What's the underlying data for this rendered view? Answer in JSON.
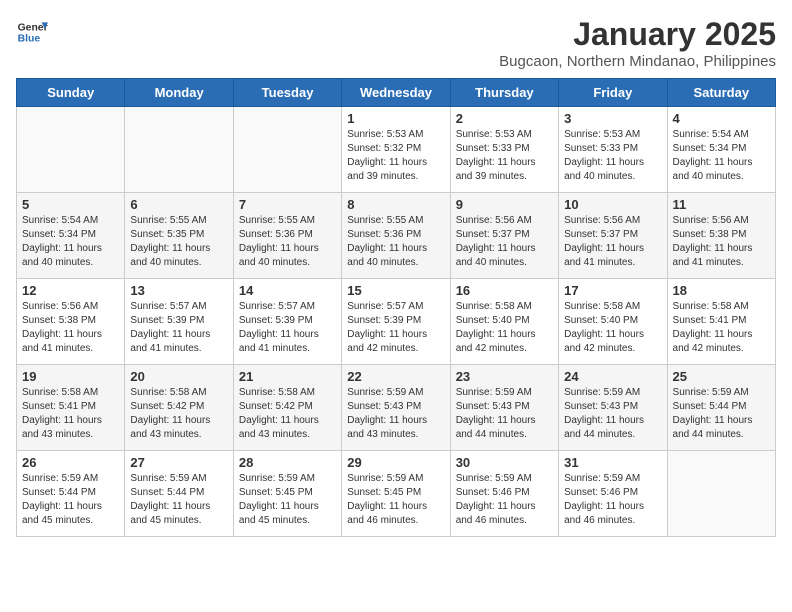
{
  "header": {
    "logo_general": "General",
    "logo_blue": "Blue",
    "title": "January 2025",
    "subtitle": "Bugcaon, Northern Mindanao, Philippines"
  },
  "days_of_week": [
    "Sunday",
    "Monday",
    "Tuesday",
    "Wednesday",
    "Thursday",
    "Friday",
    "Saturday"
  ],
  "weeks": [
    [
      {
        "day": "",
        "sunrise": "",
        "sunset": "",
        "daylight": ""
      },
      {
        "day": "",
        "sunrise": "",
        "sunset": "",
        "daylight": ""
      },
      {
        "day": "",
        "sunrise": "",
        "sunset": "",
        "daylight": ""
      },
      {
        "day": "1",
        "sunrise": "Sunrise: 5:53 AM",
        "sunset": "Sunset: 5:32 PM",
        "daylight": "Daylight: 11 hours and 39 minutes."
      },
      {
        "day": "2",
        "sunrise": "Sunrise: 5:53 AM",
        "sunset": "Sunset: 5:33 PM",
        "daylight": "Daylight: 11 hours and 39 minutes."
      },
      {
        "day": "3",
        "sunrise": "Sunrise: 5:53 AM",
        "sunset": "Sunset: 5:33 PM",
        "daylight": "Daylight: 11 hours and 40 minutes."
      },
      {
        "day": "4",
        "sunrise": "Sunrise: 5:54 AM",
        "sunset": "Sunset: 5:34 PM",
        "daylight": "Daylight: 11 hours and 40 minutes."
      }
    ],
    [
      {
        "day": "5",
        "sunrise": "Sunrise: 5:54 AM",
        "sunset": "Sunset: 5:34 PM",
        "daylight": "Daylight: 11 hours and 40 minutes."
      },
      {
        "day": "6",
        "sunrise": "Sunrise: 5:55 AM",
        "sunset": "Sunset: 5:35 PM",
        "daylight": "Daylight: 11 hours and 40 minutes."
      },
      {
        "day": "7",
        "sunrise": "Sunrise: 5:55 AM",
        "sunset": "Sunset: 5:36 PM",
        "daylight": "Daylight: 11 hours and 40 minutes."
      },
      {
        "day": "8",
        "sunrise": "Sunrise: 5:55 AM",
        "sunset": "Sunset: 5:36 PM",
        "daylight": "Daylight: 11 hours and 40 minutes."
      },
      {
        "day": "9",
        "sunrise": "Sunrise: 5:56 AM",
        "sunset": "Sunset: 5:37 PM",
        "daylight": "Daylight: 11 hours and 40 minutes."
      },
      {
        "day": "10",
        "sunrise": "Sunrise: 5:56 AM",
        "sunset": "Sunset: 5:37 PM",
        "daylight": "Daylight: 11 hours and 41 minutes."
      },
      {
        "day": "11",
        "sunrise": "Sunrise: 5:56 AM",
        "sunset": "Sunset: 5:38 PM",
        "daylight": "Daylight: 11 hours and 41 minutes."
      }
    ],
    [
      {
        "day": "12",
        "sunrise": "Sunrise: 5:56 AM",
        "sunset": "Sunset: 5:38 PM",
        "daylight": "Daylight: 11 hours and 41 minutes."
      },
      {
        "day": "13",
        "sunrise": "Sunrise: 5:57 AM",
        "sunset": "Sunset: 5:39 PM",
        "daylight": "Daylight: 11 hours and 41 minutes."
      },
      {
        "day": "14",
        "sunrise": "Sunrise: 5:57 AM",
        "sunset": "Sunset: 5:39 PM",
        "daylight": "Daylight: 11 hours and 41 minutes."
      },
      {
        "day": "15",
        "sunrise": "Sunrise: 5:57 AM",
        "sunset": "Sunset: 5:39 PM",
        "daylight": "Daylight: 11 hours and 42 minutes."
      },
      {
        "day": "16",
        "sunrise": "Sunrise: 5:58 AM",
        "sunset": "Sunset: 5:40 PM",
        "daylight": "Daylight: 11 hours and 42 minutes."
      },
      {
        "day": "17",
        "sunrise": "Sunrise: 5:58 AM",
        "sunset": "Sunset: 5:40 PM",
        "daylight": "Daylight: 11 hours and 42 minutes."
      },
      {
        "day": "18",
        "sunrise": "Sunrise: 5:58 AM",
        "sunset": "Sunset: 5:41 PM",
        "daylight": "Daylight: 11 hours and 42 minutes."
      }
    ],
    [
      {
        "day": "19",
        "sunrise": "Sunrise: 5:58 AM",
        "sunset": "Sunset: 5:41 PM",
        "daylight": "Daylight: 11 hours and 43 minutes."
      },
      {
        "day": "20",
        "sunrise": "Sunrise: 5:58 AM",
        "sunset": "Sunset: 5:42 PM",
        "daylight": "Daylight: 11 hours and 43 minutes."
      },
      {
        "day": "21",
        "sunrise": "Sunrise: 5:58 AM",
        "sunset": "Sunset: 5:42 PM",
        "daylight": "Daylight: 11 hours and 43 minutes."
      },
      {
        "day": "22",
        "sunrise": "Sunrise: 5:59 AM",
        "sunset": "Sunset: 5:43 PM",
        "daylight": "Daylight: 11 hours and 43 minutes."
      },
      {
        "day": "23",
        "sunrise": "Sunrise: 5:59 AM",
        "sunset": "Sunset: 5:43 PM",
        "daylight": "Daylight: 11 hours and 44 minutes."
      },
      {
        "day": "24",
        "sunrise": "Sunrise: 5:59 AM",
        "sunset": "Sunset: 5:43 PM",
        "daylight": "Daylight: 11 hours and 44 minutes."
      },
      {
        "day": "25",
        "sunrise": "Sunrise: 5:59 AM",
        "sunset": "Sunset: 5:44 PM",
        "daylight": "Daylight: 11 hours and 44 minutes."
      }
    ],
    [
      {
        "day": "26",
        "sunrise": "Sunrise: 5:59 AM",
        "sunset": "Sunset: 5:44 PM",
        "daylight": "Daylight: 11 hours and 45 minutes."
      },
      {
        "day": "27",
        "sunrise": "Sunrise: 5:59 AM",
        "sunset": "Sunset: 5:44 PM",
        "daylight": "Daylight: 11 hours and 45 minutes."
      },
      {
        "day": "28",
        "sunrise": "Sunrise: 5:59 AM",
        "sunset": "Sunset: 5:45 PM",
        "daylight": "Daylight: 11 hours and 45 minutes."
      },
      {
        "day": "29",
        "sunrise": "Sunrise: 5:59 AM",
        "sunset": "Sunset: 5:45 PM",
        "daylight": "Daylight: 11 hours and 46 minutes."
      },
      {
        "day": "30",
        "sunrise": "Sunrise: 5:59 AM",
        "sunset": "Sunset: 5:46 PM",
        "daylight": "Daylight: 11 hours and 46 minutes."
      },
      {
        "day": "31",
        "sunrise": "Sunrise: 5:59 AM",
        "sunset": "Sunset: 5:46 PM",
        "daylight": "Daylight: 11 hours and 46 minutes."
      },
      {
        "day": "",
        "sunrise": "",
        "sunset": "",
        "daylight": ""
      }
    ]
  ]
}
